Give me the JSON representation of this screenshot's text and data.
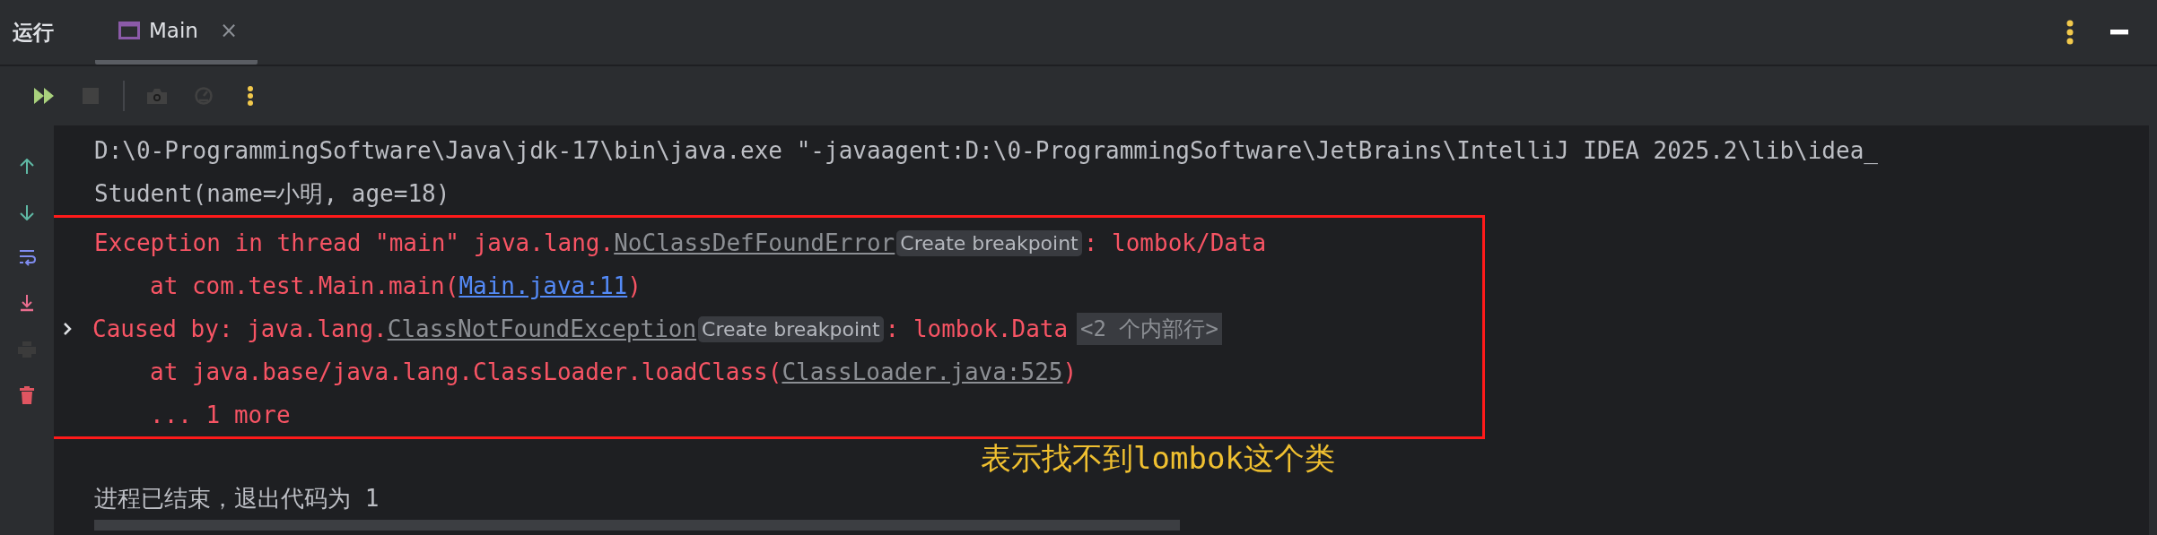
{
  "header": {
    "title": "运行",
    "tabs": [
      {
        "label": "Main",
        "selected": true,
        "close": "×"
      }
    ]
  },
  "toolbar": [
    {
      "kind": "rerun",
      "disabled": false
    },
    {
      "kind": "stop",
      "disabled": true
    },
    {
      "kind": "separator",
      "disabled": false
    },
    {
      "kind": "camera",
      "disabled": true
    },
    {
      "kind": "gauge",
      "disabled": true
    },
    {
      "kind": "more",
      "disabled": false
    }
  ],
  "gutter": [
    {
      "kind": "up",
      "disabled": false
    },
    {
      "kind": "down",
      "disabled": false
    },
    {
      "kind": "wrap",
      "disabled": false
    },
    {
      "kind": "scroll-end",
      "disabled": false
    },
    {
      "kind": "print",
      "disabled": true
    },
    {
      "kind": "trash",
      "disabled": false
    }
  ],
  "console": {
    "lines": [
      {
        "kind": "plain",
        "indent": false,
        "segments": [
          {
            "kind": "text",
            "text": "D:\\0-ProgrammingSoftware\\Java\\jdk-17\\bin\\java.exe \"-javaagent:D:\\0-ProgrammingSoftware\\JetBrains\\IntelliJ IDEA 2025.2\\lib\\idea_"
          }
        ]
      },
      {
        "kind": "plain",
        "indent": false,
        "segments": [
          {
            "kind": "text",
            "text": "Student(name=小明, age=18)"
          }
        ]
      }
    ],
    "highlight": {
      "lines": [
        {
          "kind": "error",
          "indent": false,
          "segments": [
            {
              "kind": "text",
              "text": "Exception in thread \"main\" java.lang."
            },
            {
              "kind": "class-ref",
              "text": "NoClassDefFoundError"
            },
            {
              "kind": "hint",
              "text": "Create breakpoint"
            },
            {
              "kind": "text",
              "text": ": lombok/Data"
            }
          ]
        },
        {
          "kind": "error",
          "indent": true,
          "segments": [
            {
              "kind": "text",
              "text": "at com.test.Main.main("
            },
            {
              "kind": "link",
              "text": "Main.java:11"
            },
            {
              "kind": "text",
              "text": ")"
            }
          ]
        },
        {
          "kind": "error",
          "indent": false,
          "expanded": false,
          "segments": [
            {
              "kind": "text",
              "text": "Caused by: java.lang."
            },
            {
              "kind": "class-ref",
              "text": "ClassNotFoundException"
            },
            {
              "kind": "hint",
              "text": "Create breakpoint"
            },
            {
              "kind": "text",
              "text": ": lombok.Data"
            },
            {
              "kind": "fold",
              "text": "<2 个内部行>"
            }
          ]
        },
        {
          "kind": "error",
          "indent": true,
          "segments": [
            {
              "kind": "text",
              "text": "at java.base/java.lang.ClassLoader.loadClass("
            },
            {
              "kind": "class-ref",
              "text": "ClassLoader.java:525"
            },
            {
              "kind": "text",
              "text": ")"
            }
          ]
        },
        {
          "kind": "error",
          "indent": true,
          "segments": [
            {
              "kind": "text",
              "text": "... 1 more"
            }
          ]
        }
      ]
    },
    "annotation": "表示找不到lombok这个类",
    "exit_message": "进程已结束，退出代码为 1"
  }
}
